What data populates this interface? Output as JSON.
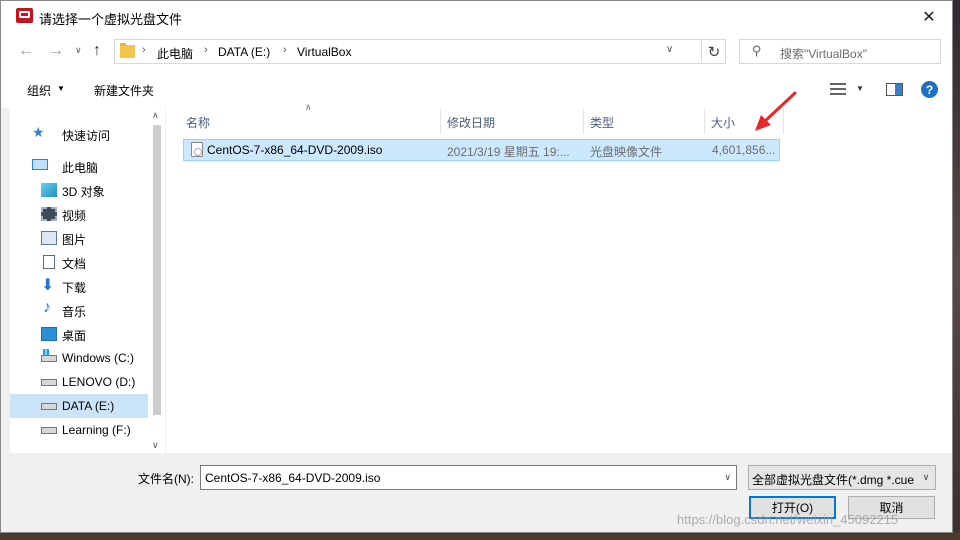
{
  "window": {
    "title": "请选择一个虚拟光盘文件",
    "close_icon": "✕"
  },
  "nav": {
    "back_icon": "←",
    "forward_icon": "→",
    "recent_icon": "∨",
    "up_icon": "↑",
    "breadcrumb": [
      "此电脑",
      "DATA (E:)",
      "VirtualBox"
    ],
    "separator": "›",
    "refresh_icon": "↻",
    "search_placeholder": "搜索\"VirtualBox\""
  },
  "toolbar": {
    "organize_label": "组织",
    "organize_caret": "▼",
    "new_folder_label": "新建文件夹",
    "view_caret": "▼",
    "help_label": "?"
  },
  "sidebar": {
    "items": [
      {
        "label": "快速访问",
        "icon": "star-icon"
      },
      {
        "label": "此电脑",
        "icon": "computer-icon"
      },
      {
        "label": "3D 对象",
        "icon": "3d-objects-icon"
      },
      {
        "label": "视频",
        "icon": "video-icon"
      },
      {
        "label": "图片",
        "icon": "pictures-icon"
      },
      {
        "label": "文档",
        "icon": "documents-icon"
      },
      {
        "label": "下载",
        "icon": "download-icon"
      },
      {
        "label": "音乐",
        "icon": "music-icon"
      },
      {
        "label": "桌面",
        "icon": "desktop-icon"
      },
      {
        "label": "Windows (C:)",
        "icon": "windows-drive-icon"
      },
      {
        "label": "LENOVO (D:)",
        "icon": "drive-icon"
      },
      {
        "label": "DATA (E:)",
        "icon": "drive-icon",
        "selected": true
      },
      {
        "label": "Learning (F:)",
        "icon": "drive-icon"
      }
    ],
    "scroll_up": "∧",
    "scroll_down": "∨"
  },
  "file_list": {
    "sort_indicator": "∧",
    "columns": [
      "名称",
      "修改日期",
      "类型",
      "大小"
    ],
    "rows": [
      {
        "name": "CentOS-7-x86_64-DVD-2009.iso",
        "date": "2021/3/19 星期五 19:...",
        "type": "光盘映像文件",
        "size": "4,601,856...",
        "selected": true
      }
    ]
  },
  "footer": {
    "filename_label": "文件名(N):",
    "filename_value": "CentOS-7-x86_64-DVD-2009.iso",
    "dropdown_caret": "∨",
    "filter_value": "全部虚拟光盘文件(*.dmg *.cue",
    "open_label": "打开(O)",
    "cancel_label": "取消"
  },
  "watermark": "https://blog.csdn.net/weixin_45092215",
  "colors": {
    "selection": "#cce8ff",
    "accent": "#0078d7",
    "annotation_arrow": "#e8262b"
  }
}
